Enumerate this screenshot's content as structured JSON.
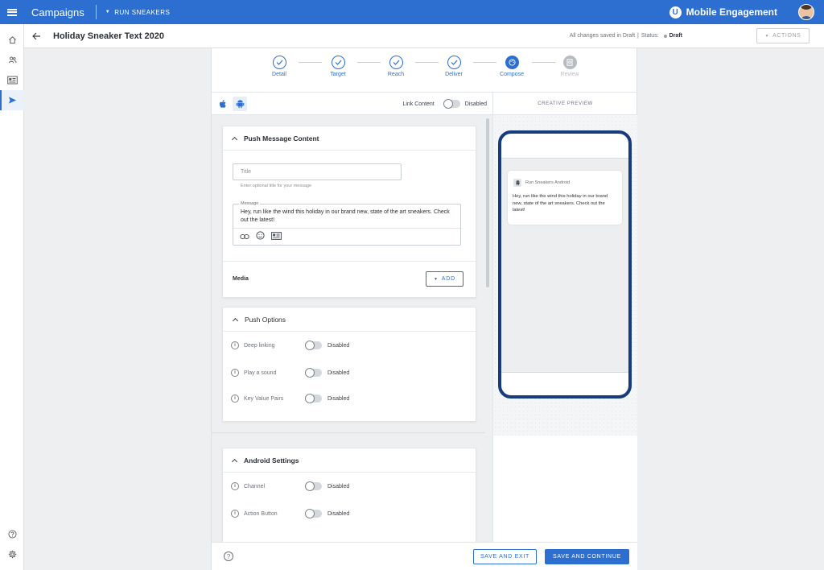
{
  "topbar": {
    "app_title": "Campaigns",
    "campaign_dropdown": "RUN SNEAKERS",
    "brand": "Mobile Engagement",
    "brand_logo_letter": "U"
  },
  "leftnav": {
    "items": [
      {
        "icon": "home-icon"
      },
      {
        "icon": "users-icon"
      },
      {
        "icon": "contact-card-icon"
      },
      {
        "icon": "send-icon",
        "active": true
      }
    ],
    "bottom": [
      {
        "icon": "help-icon"
      },
      {
        "icon": "settings-icon"
      }
    ]
  },
  "header": {
    "title": "Holiday Sneaker Text 2020",
    "saved_text": "All changes saved in Draft",
    "separator": "|",
    "status_label": "Status:",
    "status_value": "Draft",
    "actions_label": "ACTIONS"
  },
  "stepper": {
    "steps": [
      {
        "label": "Detail",
        "state": "done"
      },
      {
        "label": "Target",
        "state": "done"
      },
      {
        "label": "Reach",
        "state": "done"
      },
      {
        "label": "Deliver",
        "state": "done"
      },
      {
        "label": "Compose",
        "state": "current"
      },
      {
        "label": "Review",
        "state": "disabled"
      }
    ]
  },
  "platforms": {
    "items": [
      {
        "icon": "apple-icon",
        "selected": false
      },
      {
        "icon": "android-icon",
        "selected": true
      }
    ],
    "link_content_label": "Link Content",
    "link_content_state": "Disabled"
  },
  "preview": {
    "header": "CREATIVE PREVIEW",
    "app_name": "Run Sneakers Android",
    "message": "Hey, run like the wind this holiday in our brand new, state of the art sneakers. Check out the latest!"
  },
  "push_message": {
    "heading": "Push Message Content",
    "title_placeholder": "Title",
    "title_hint": "Enter optional title for your message",
    "message_label": "Message",
    "message_value": "Hey, run like the wind this holiday in our brand new, state of the art sneakers. Check out the latest!",
    "media_label": "Media",
    "add_label": "ADD"
  },
  "push_options": {
    "heading": "Push Options",
    "rows": [
      {
        "name": "Deep linking",
        "state": "Disabled"
      },
      {
        "name": "Play a sound",
        "state": "Disabled"
      },
      {
        "name": "Key Value Pairs",
        "state": "Disabled"
      }
    ]
  },
  "android_settings": {
    "heading": "Android Settings",
    "rows": [
      {
        "name": "Channel",
        "state": "Disabled"
      },
      {
        "name": "Action Button",
        "state": "Disabled"
      }
    ]
  },
  "footer": {
    "save_exit": "SAVE AND EXIT",
    "save_continue": "SAVE AND CONTINUE"
  },
  "colors": {
    "primary": "#2c6fd1",
    "phone_frame": "#163c7e",
    "disabled": "#b7bcc2"
  }
}
